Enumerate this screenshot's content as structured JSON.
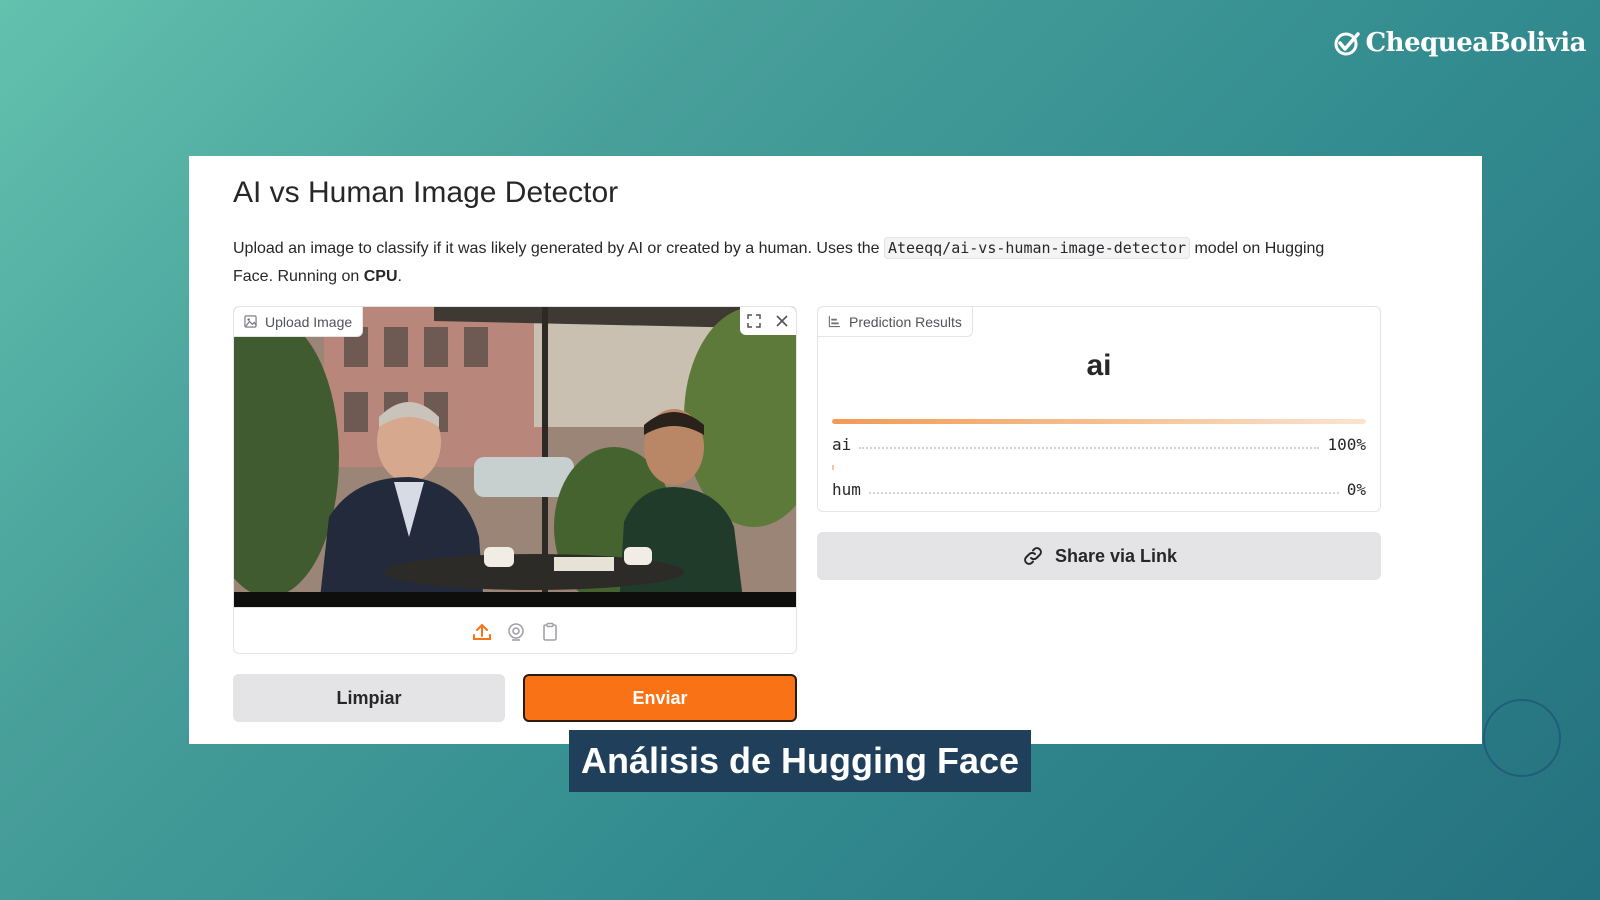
{
  "brand": {
    "name": "ChequeaBolivia"
  },
  "app": {
    "title": "AI vs Human Image Detector",
    "description_pre": "Upload an image to classify if it was likely generated by AI or created by a human. Uses the ",
    "model_code": "Ateeqq/ai-vs-human-image-detector",
    "description_mid": " model on Hugging Face. Running on ",
    "device": "CPU",
    "description_post": "."
  },
  "upload": {
    "label": "Upload Image",
    "tools": [
      "fullscreen-icon",
      "close-icon"
    ],
    "footer_icons": [
      "upload-icon",
      "webcam-icon",
      "clipboard-icon"
    ]
  },
  "results": {
    "label": "Prediction Results",
    "top_label": "ai",
    "confidences": [
      {
        "label": "ai",
        "value": "100%",
        "fraction": 1.0
      },
      {
        "label": "hum",
        "value": "0%",
        "fraction": 0.0
      }
    ]
  },
  "buttons": {
    "clear": "Limpiar",
    "submit": "Enviar",
    "share": "Share via Link"
  },
  "caption": "Análisis de Hugging Face",
  "colors": {
    "accent": "#f97316",
    "caption_bg": "#1f3f5a"
  }
}
